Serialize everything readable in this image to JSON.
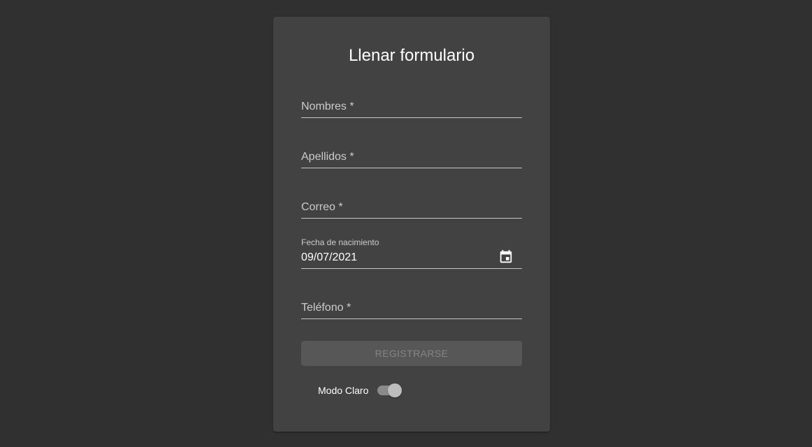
{
  "form": {
    "title": "Llenar formulario",
    "fields": {
      "nombres": {
        "label": "Nombres *"
      },
      "apellidos": {
        "label": "Apellidos *"
      },
      "correo": {
        "label": "Correo *"
      },
      "fecha": {
        "label": "Fecha de nacimiento",
        "value": "09/07/2021",
        "icon": "calendar-icon"
      },
      "telefono": {
        "label": "Teléfono *"
      }
    },
    "submit_label": "REGISTRARSE",
    "theme_toggle": {
      "label": "Modo Claro",
      "checked": true
    }
  },
  "colors": {
    "background": "#303030",
    "card": "#424242",
    "button_disabled": "#575757",
    "button_text_disabled": "#858585",
    "text": "#ffffff"
  }
}
